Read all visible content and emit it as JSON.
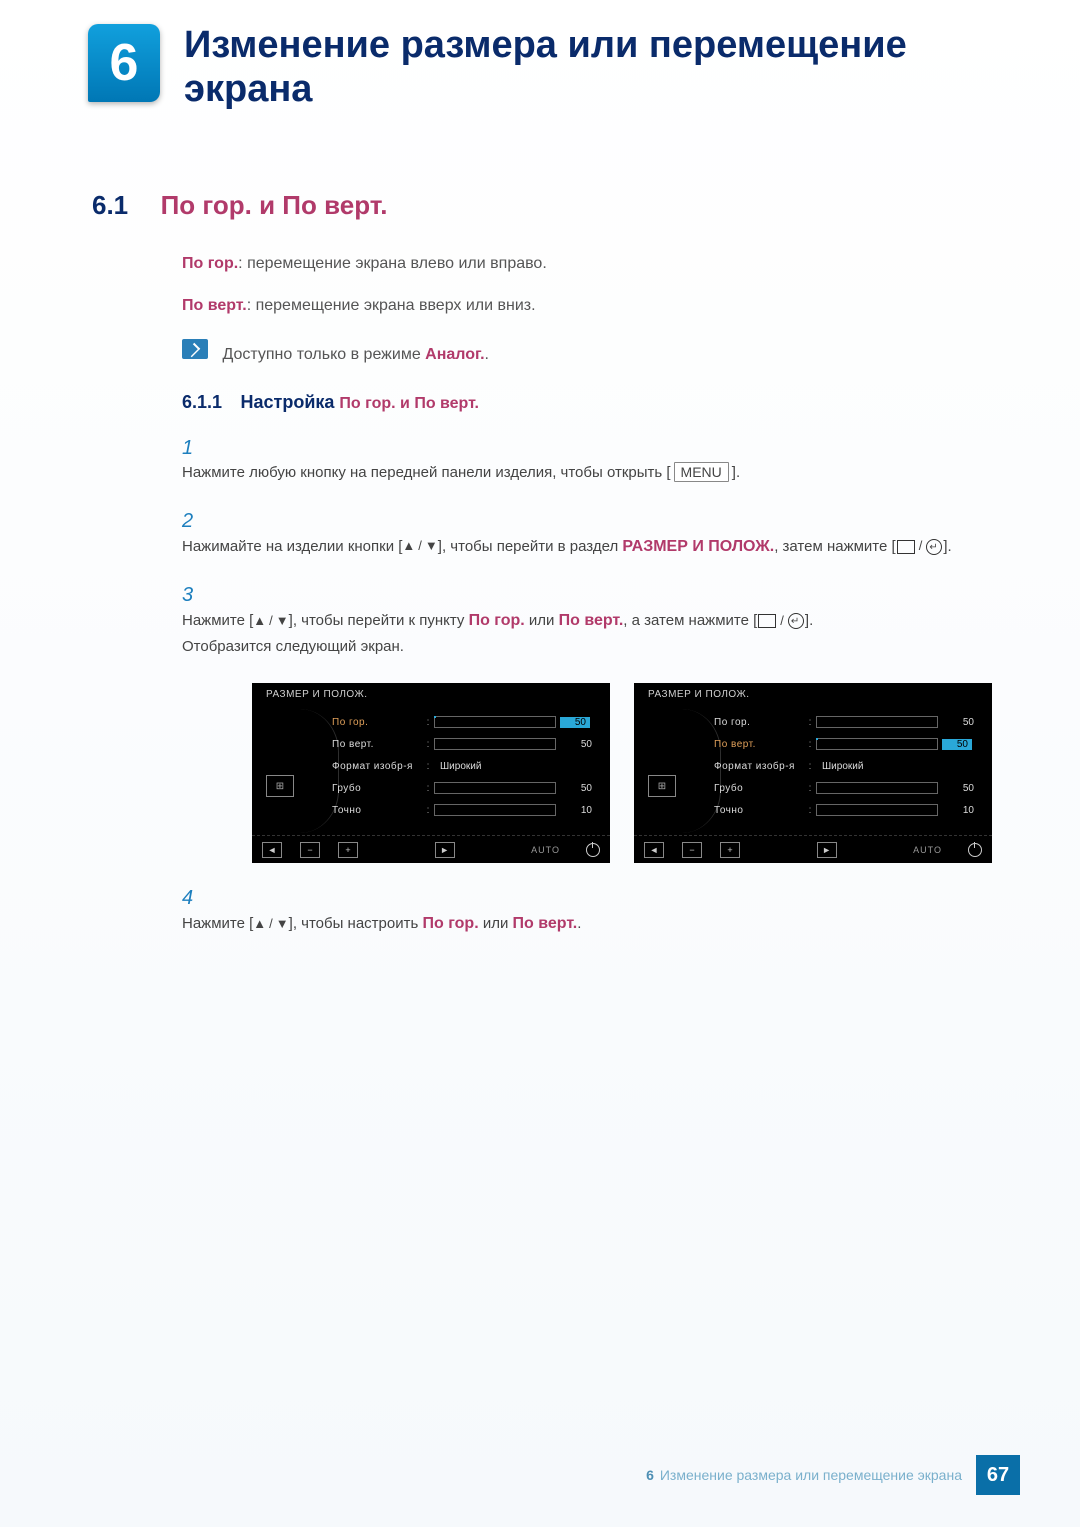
{
  "chapter": {
    "number": "6",
    "title_line1": "Изменение размера или перемещение",
    "title_line2": "экрана"
  },
  "section": {
    "number": "6.1",
    "title": "По гор. и По верт."
  },
  "defs": {
    "h_label": "По гор.",
    "h_sep": ": ",
    "h_text": "перемещение экрана влево или вправо.",
    "v_label": "По верт.",
    "v_sep": ": ",
    "v_text": "перемещение экрана вверх или вниз."
  },
  "note": {
    "text_pre": "Доступно только в режиме ",
    "analog": "Аналог.",
    "text_post": "."
  },
  "subsection": {
    "number": "6.1.1",
    "title_pre": "Настройка ",
    "title_hl": "По гор. и По верт."
  },
  "steps": {
    "s1": {
      "num": "1",
      "pre": "Нажмите любую кнопку на передней панели изделия, чтобы открыть ",
      "menu": "MENU",
      "post": "."
    },
    "s2": {
      "num": "2",
      "pre": "Нажимайте на изделии кнопки [",
      "between": "], чтобы перейти в раздел ",
      "razdel": "РАЗМЕР И ПОЛОЖ.",
      "mid": ", затем нажмите [",
      "post": "]."
    },
    "s3": {
      "num": "3",
      "pre": "Нажмите [",
      "mid1": "], чтобы перейти к пункту ",
      "hgor": "По гор.",
      "or": " или ",
      "vert": "По верт.",
      "mid2": ", а затем нажмите [",
      "tail": "Отобразится следующий экран."
    },
    "s4": {
      "num": "4",
      "pre": "Нажмите [",
      "mid": "], чтобы настроить ",
      "hgor": "По гор.",
      "or": " или ",
      "vert": "По верт.",
      "post": "."
    }
  },
  "osd": {
    "title": "РАЗМЕР И ПОЛОЖ.",
    "rows": [
      {
        "label": "По гор.",
        "val": "50",
        "fill": 60
      },
      {
        "label": "По верт.",
        "val": "50",
        "fill": 30
      },
      {
        "label": "Формат изобр-я",
        "text": "Широкий"
      },
      {
        "label": "Грубо",
        "val": "50",
        "fill": 30
      },
      {
        "label": "Точно",
        "val": "10",
        "fill": 8
      }
    ],
    "auto": "AUTO"
  },
  "footer": {
    "chap": "6",
    "text": "Изменение размера или перемещение экрана",
    "page": "67"
  }
}
